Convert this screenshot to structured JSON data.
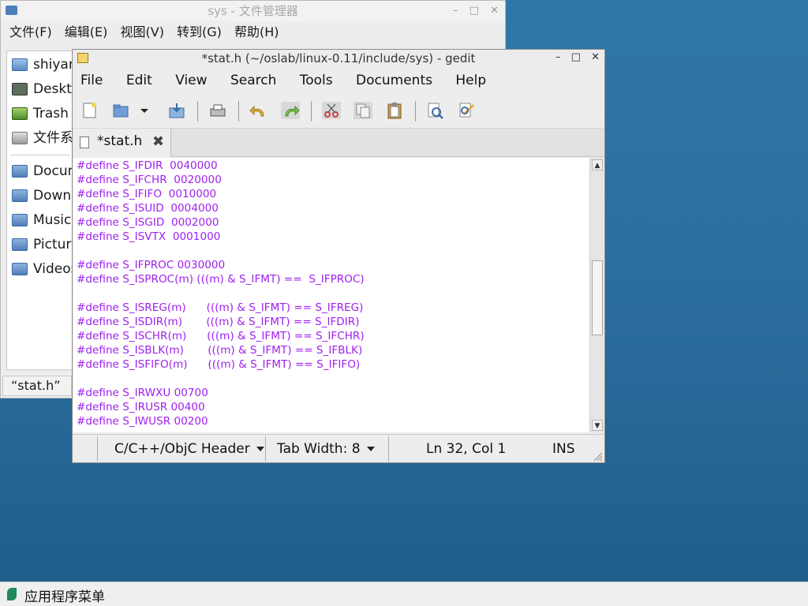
{
  "file_manager": {
    "title": "sys - 文件管理器",
    "menu": [
      "文件(F)",
      "编辑(E)",
      "视图(V)",
      "转到(G)",
      "帮助(H)"
    ],
    "sidebar_places": [
      {
        "label": "shiyanlou",
        "icon": "home-folder-icon"
      },
      {
        "label": "Desktop",
        "icon": "desktop-icon"
      },
      {
        "label": "Trash",
        "icon": "trash-icon"
      },
      {
        "label": "文件系统",
        "icon": "drive-icon"
      }
    ],
    "sidebar_bookmarks": [
      {
        "label": "Documents",
        "icon": "folder-icon"
      },
      {
        "label": "Downloads",
        "icon": "folder-icon"
      },
      {
        "label": "Music",
        "icon": "folder-icon"
      },
      {
        "label": "Pictures",
        "icon": "folder-icon"
      },
      {
        "label": "Videos",
        "icon": "folder-icon"
      }
    ],
    "status": "“stat.h”"
  },
  "gedit": {
    "title": "*stat.h (~/oslab/linux-0.11/include/sys) - gedit",
    "menu": [
      "File",
      "Edit",
      "View",
      "Search",
      "Tools",
      "Documents",
      "Help"
    ],
    "tab_label": "*stat.h",
    "code_lines": [
      "#define S_IFDIR  0040000",
      "#define S_IFCHR  0020000",
      "#define S_IFIFO  0010000",
      "#define S_ISUID  0004000",
      "#define S_ISGID  0002000",
      "#define S_ISVTX  0001000",
      "",
      "#define S_IFPROC 0030000",
      "#define S_ISPROC(m) (((m) & S_IFMT) ==  S_IFPROC)",
      "",
      "#define S_ISREG(m)      (((m) & S_IFMT) == S_IFREG)",
      "#define S_ISDIR(m)       (((m) & S_IFMT) == S_IFDIR)",
      "#define S_ISCHR(m)      (((m) & S_IFMT) == S_IFCHR)",
      "#define S_ISBLK(m)       (((m) & S_IFMT) == S_IFBLK)",
      "#define S_ISFIFO(m)      (((m) & S_IFMT) == S_IFIFO)",
      "",
      "#define S_IRWXU 00700",
      "#define S_IRUSR 00400",
      "#define S_IWUSR 00200"
    ],
    "status": {
      "language": "C/C++/ObjC Header",
      "tab_width": "Tab Width:  8",
      "position": "Ln 32, Col 1",
      "mode": "INS"
    },
    "code_color": "#a020f0"
  },
  "taskbar": {
    "app_menu_label": "应用程序菜单"
  }
}
